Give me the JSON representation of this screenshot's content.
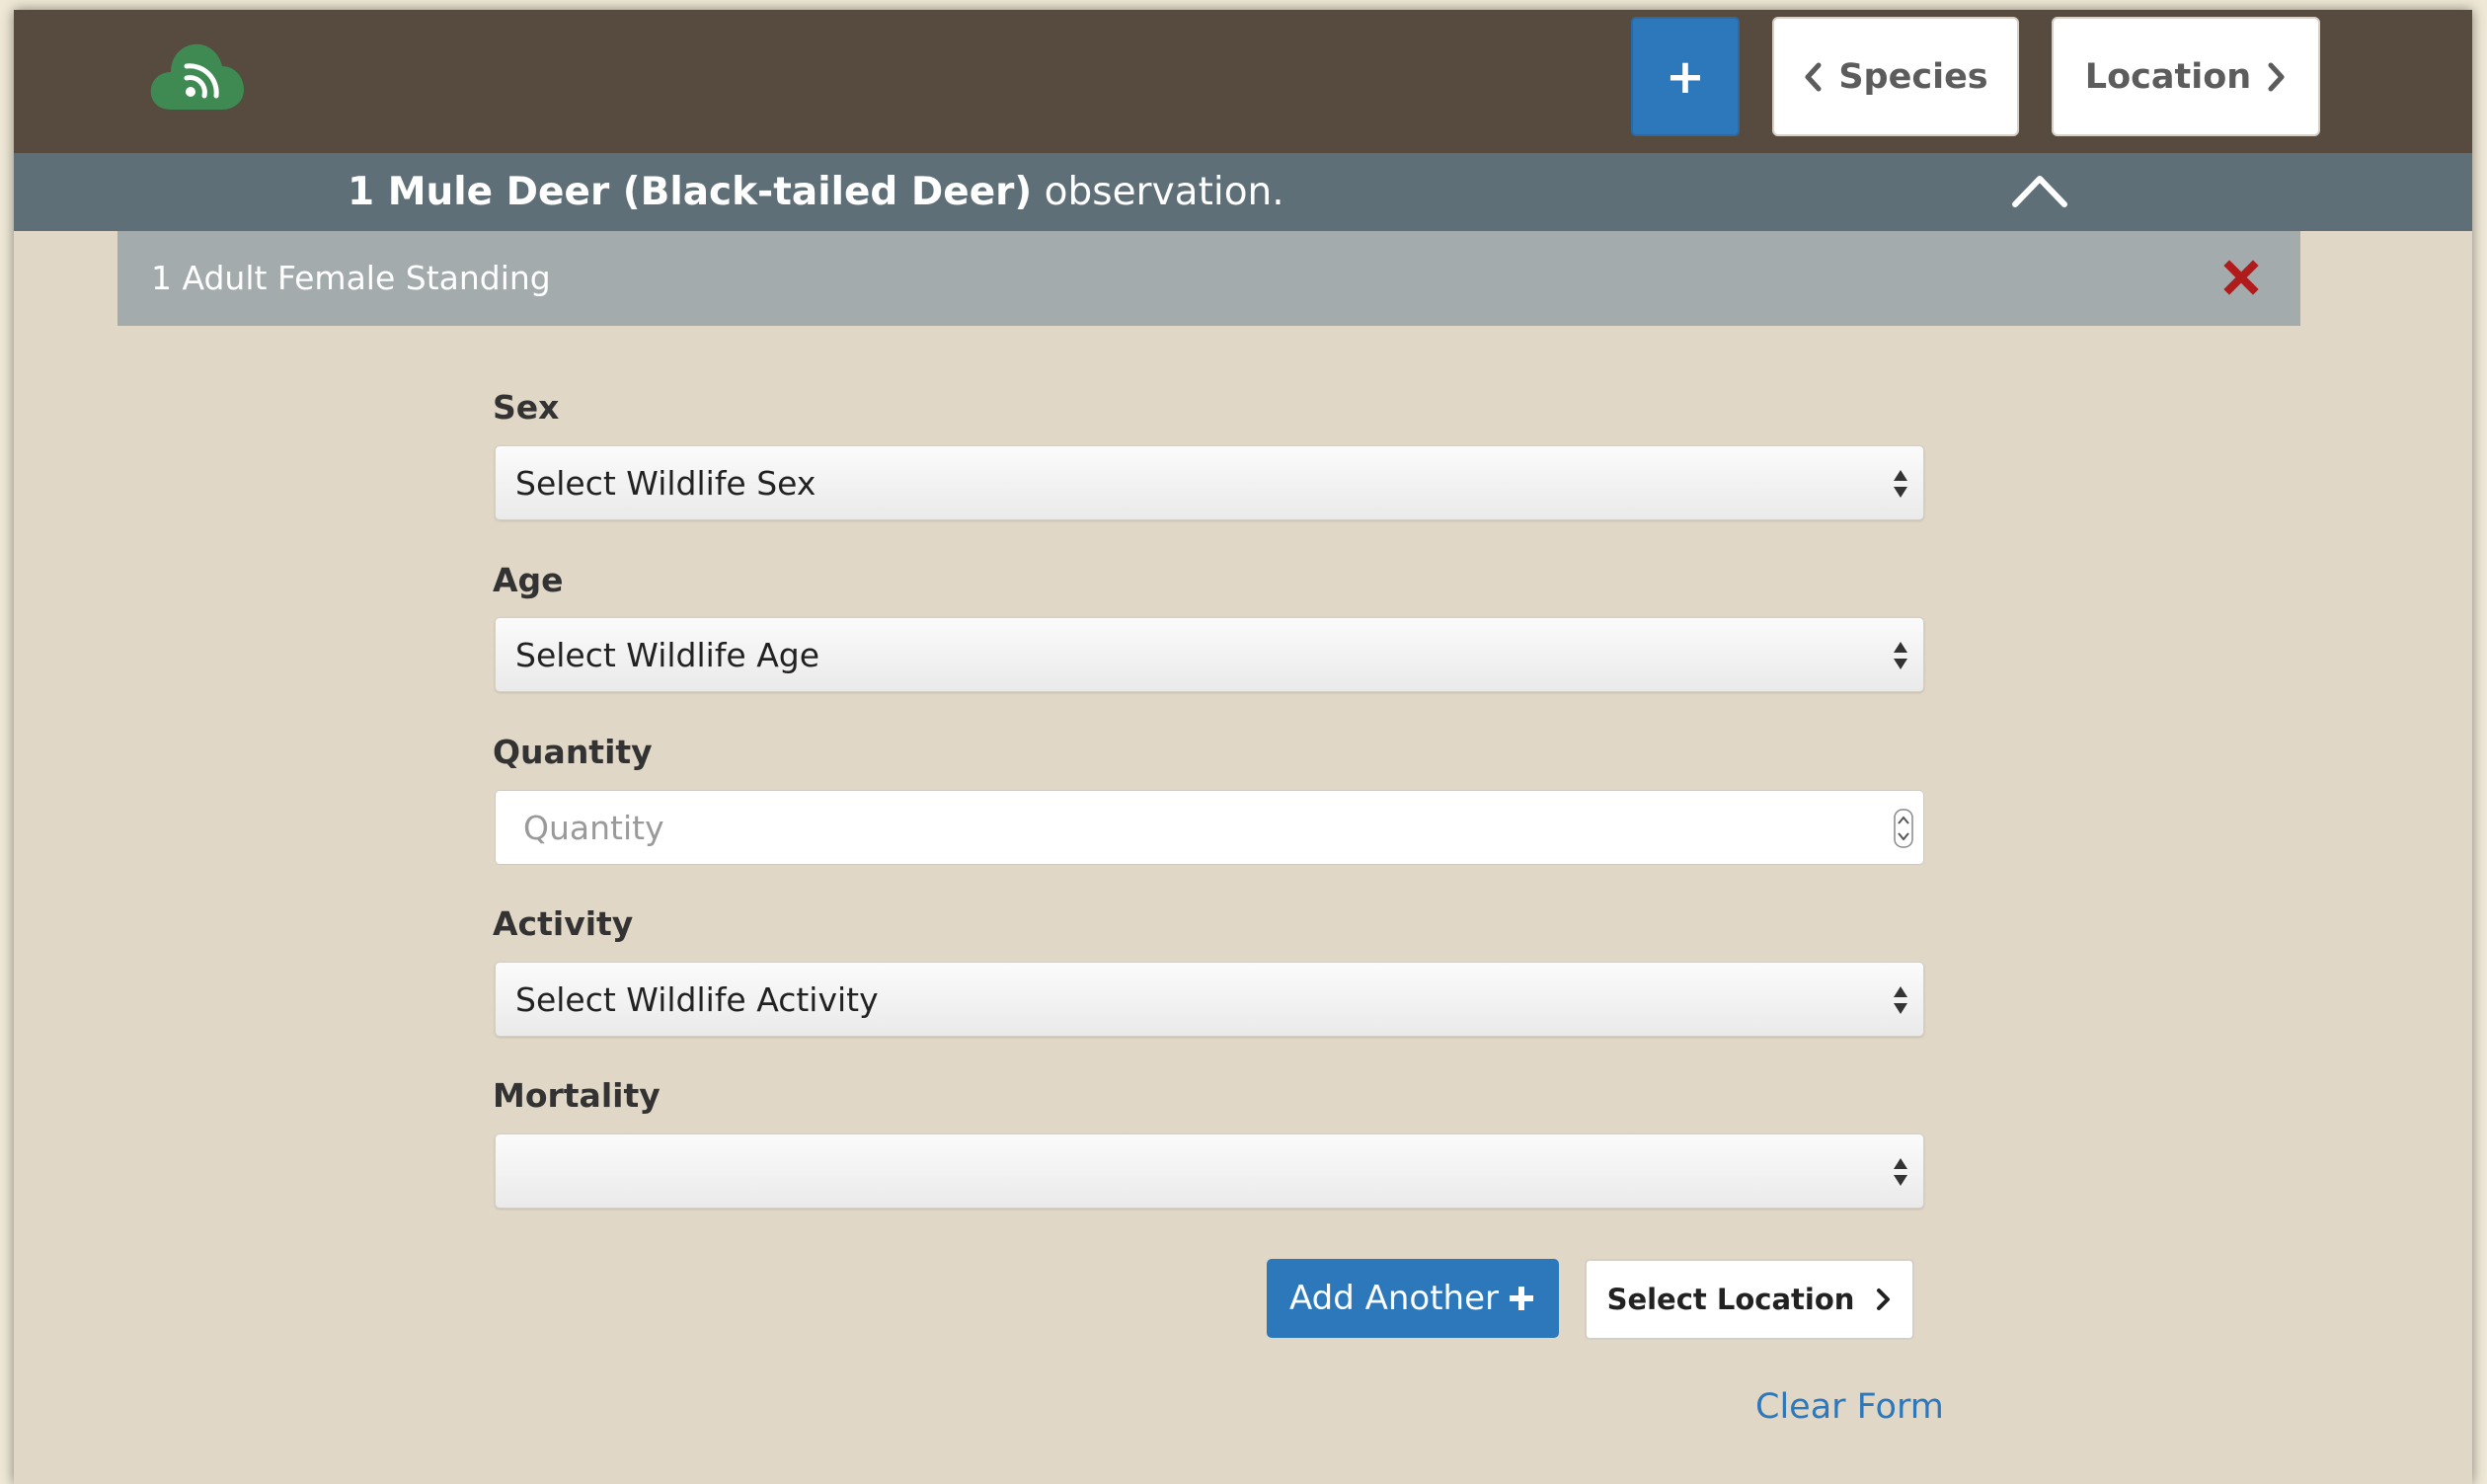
{
  "header": {
    "logo_icon": "cloud-rss-icon",
    "add_button_icon": "plus-icon",
    "species_button": {
      "label": "Species",
      "icon": "chevron-left-icon"
    },
    "location_button": {
      "label": "Location",
      "icon": "chevron-right-icon"
    }
  },
  "observation": {
    "summary_bold": "1 Mule Deer (Black-tailed Deer)",
    "summary_rest": " observation.",
    "collapse_icon": "chevron-up-icon"
  },
  "entry": {
    "label": "1 Adult Female Standing",
    "remove_icon": "close-icon"
  },
  "form": {
    "sex": {
      "label": "Sex",
      "value": "Select Wildlife Sex"
    },
    "age": {
      "label": "Age",
      "value": "Select Wildlife Age"
    },
    "quantity": {
      "label": "Quantity",
      "placeholder": "Quantity"
    },
    "activity": {
      "label": "Activity",
      "value": "Select Wildlife Activity"
    },
    "mortality": {
      "label": "Mortality",
      "value": ""
    }
  },
  "actions": {
    "add_another": "Add Another",
    "select_location": "Select Location",
    "clear_form": "Clear Form"
  },
  "colors": {
    "topbar": "#574a3e",
    "observation_bar": "#5f6f77",
    "entry_bar": "#a4abad",
    "background": "#e0d7c6",
    "primary": "#2d78bb",
    "remove": "#b01c1c",
    "logo": "#3e8a52"
  }
}
